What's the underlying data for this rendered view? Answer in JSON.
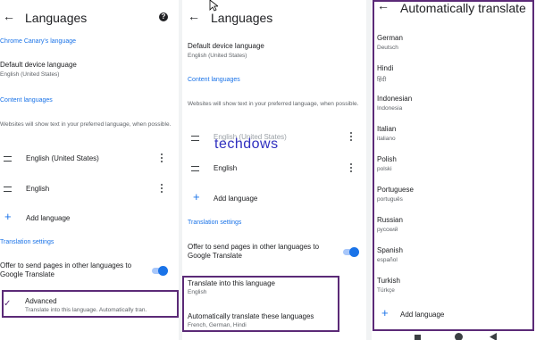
{
  "panel1": {
    "title": "Languages",
    "section_chrome": "Chrome Canary's language",
    "default_device_title": "Default device language",
    "default_device_sub": "English (United States)",
    "section_content": "Content languages",
    "content_desc": "Websites will show text in your preferred language, when possible.",
    "languages": [
      {
        "label": "English (United States)"
      },
      {
        "label": "English"
      }
    ],
    "add_language": "Add language",
    "section_translation": "Translation settings",
    "offer_translate": "Offer to send pages in other languages to Google Translate",
    "advanced_title": "Advanced",
    "advanced_sub": "Translate into this language. Automatically tran."
  },
  "panel2": {
    "title": "Languages",
    "default_device_title": "Default device language",
    "default_device_sub": "English (United States)",
    "section_content": "Content languages",
    "content_desc": "Websites will show text in your preferred language, when possible.",
    "languages": [
      {
        "label": "English (United States)"
      },
      {
        "label": "English"
      }
    ],
    "watermark": "techdows",
    "add_language": "Add language",
    "section_translation": "Translation settings",
    "offer_translate": "Offer to send pages in other languages to Google Translate",
    "translate_into_title": "Translate into this language",
    "translate_into_sub": "English",
    "auto_translate_title": "Automatically translate these languages",
    "auto_translate_sub": "French, German, Hindi"
  },
  "panel3": {
    "title": "Automatically translate",
    "languages": [
      {
        "name": "German",
        "native": "Deutsch"
      },
      {
        "name": "Hindi",
        "native": "हिंदी"
      },
      {
        "name": "Indonesian",
        "native": "Indonesia"
      },
      {
        "name": "Italian",
        "native": "italiano"
      },
      {
        "name": "Polish",
        "native": "polski"
      },
      {
        "name": "Portuguese",
        "native": "português"
      },
      {
        "name": "Russian",
        "native": "русский"
      },
      {
        "name": "Spanish",
        "native": "español"
      },
      {
        "name": "Turkish",
        "native": "Türkçe"
      }
    ],
    "add_language": "Add language"
  },
  "icons": {
    "back": "arrow-left-icon",
    "help": "help-circle-icon",
    "drag": "drag-handle-icon",
    "more": "more-vertical-icon",
    "add": "plus-icon"
  },
  "colors": {
    "accent": "#1a73e8",
    "highlight_box": "#5b2a77",
    "watermark": "#2f2fbf"
  }
}
